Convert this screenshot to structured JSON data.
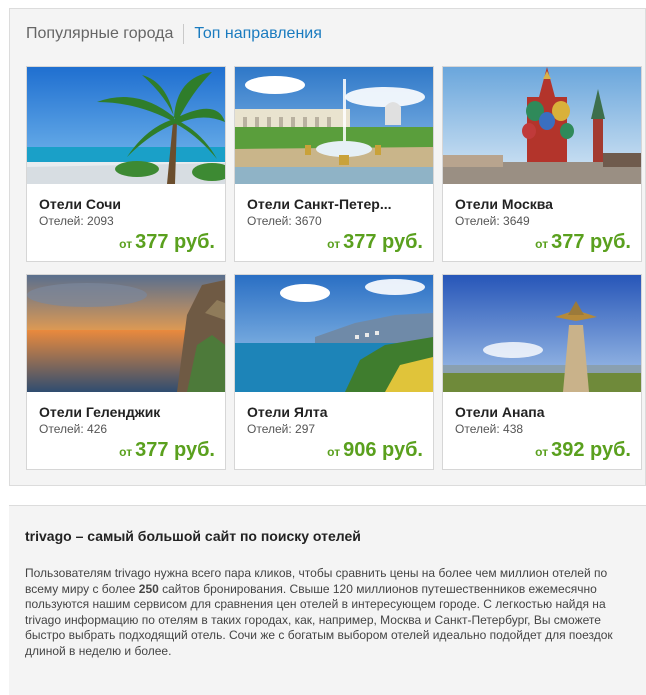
{
  "tabs": {
    "popular": "Популярные города",
    "top": "Топ направления"
  },
  "cities": [
    {
      "name": "Отели Сочи",
      "count_label": "Отелей:",
      "count": "2093",
      "from": "от",
      "price": "377 руб."
    },
    {
      "name": "Отели Санкт-Петер...",
      "count_label": "Отелей:",
      "count": "3670",
      "from": "от",
      "price": "377 руб."
    },
    {
      "name": "Отели Москва",
      "count_label": "Отелей:",
      "count": "3649",
      "from": "от",
      "price": "377 руб."
    },
    {
      "name": "Отели Геленджик",
      "count_label": "Отелей:",
      "count": "426",
      "from": "от",
      "price": "377 руб."
    },
    {
      "name": "Отели Ялта",
      "count_label": "Отелей:",
      "count": "297",
      "from": "от",
      "price": "906 руб."
    },
    {
      "name": "Отели Анапа",
      "count_label": "Отелей:",
      "count": "438",
      "from": "от",
      "price": "392 руб."
    }
  ],
  "info": {
    "title": "trivago – самый большой сайт по поиску отелей",
    "text_before": "Пользователям trivago нужна всего пара кликов, чтобы сравнить цены на более чем миллион отелей по всему миру с более ",
    "text_bold": "250",
    "text_after": " сайтов бронирования. Свыше 120 миллионов путешественников ежемесячно пользуются нашим сервисом для сравнения цен отелей в интересующем городе. С легкостью найдя на trivago информацию по отелям в таких городах, как, например, Москва и Санкт-Петербург, Вы сможете быстро выбрать подходящий отель. Сочи же с богатым выбором отелей идеально подойдет для поездок длиной в неделю и более."
  },
  "colors": {
    "link": "#1a7bbf",
    "price": "#5aa01e",
    "panel_bg": "#f4f4f4"
  }
}
